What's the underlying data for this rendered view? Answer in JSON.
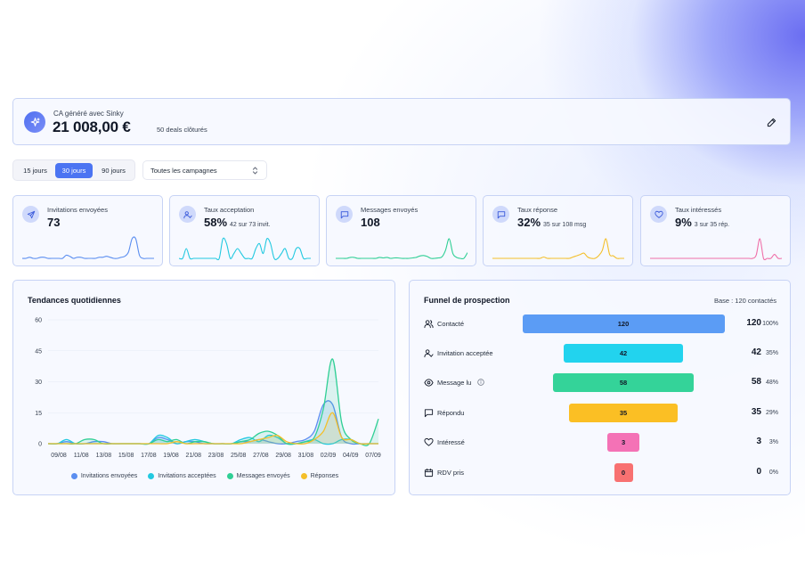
{
  "banner": {
    "label": "CA généré avec Sinky",
    "amount": "21 008,00 €",
    "deals": "50 deals clôturés"
  },
  "periods": [
    {
      "label": "15 jours",
      "active": false
    },
    {
      "label": "30 jours",
      "active": true
    },
    {
      "label": "90 jours",
      "active": false
    }
  ],
  "campaign_select": {
    "value": "Toutes les campagnes"
  },
  "kpis": [
    {
      "title": "Invitations envoyées",
      "value": "73",
      "sub": "",
      "color": "#5b8ef0",
      "icon": "send-icon"
    },
    {
      "title": "Taux acceptation",
      "value": "58%",
      "sub": "42 sur 73 invit.",
      "color": "#22c9e0",
      "icon": "user-check-icon"
    },
    {
      "title": "Messages envoyés",
      "value": "108",
      "sub": "",
      "color": "#2fcf95",
      "icon": "message-icon"
    },
    {
      "title": "Taux réponse",
      "value": "32%",
      "sub": "35 sur 108 msg",
      "color": "#f4bf2a",
      "icon": "chat-icon"
    },
    {
      "title": "Taux intéressés",
      "value": "9%",
      "sub": "3 sur 35 rép.",
      "color": "#ef6fa8",
      "icon": "heart-icon"
    }
  ],
  "trend": {
    "title": "Tendances quotidiennes",
    "legend": [
      "Invitations envoyées",
      "Invitations acceptées",
      "Messages envoyés",
      "Réponses"
    ]
  },
  "chart_data": {
    "type": "area",
    "title": "Tendances quotidiennes",
    "x_ticks": [
      "09/08",
      "11/08",
      "13/08",
      "15/08",
      "17/08",
      "19/08",
      "21/08",
      "23/08",
      "25/08",
      "27/08",
      "29/08",
      "31/08",
      "02/09",
      "04/09",
      "07/09"
    ],
    "y_ticks": [
      0,
      15,
      30,
      45,
      60
    ],
    "ylim": [
      0,
      60
    ],
    "n_points": 31,
    "series": [
      {
        "name": "Invitations envoyées",
        "color": "#5b8ef0",
        "values": [
          0,
          0,
          1,
          0,
          0,
          1,
          1,
          0,
          0,
          0,
          0,
          0,
          3,
          2,
          0,
          1,
          1,
          0,
          0,
          0,
          0,
          1,
          1,
          2,
          1,
          0,
          0,
          1,
          2,
          6,
          19,
          19,
          3,
          0,
          0,
          0,
          0
        ]
      },
      {
        "name": "Invitations acceptées",
        "color": "#22c9e0",
        "values": [
          0,
          0,
          2,
          0,
          0,
          0,
          0,
          0,
          0,
          0,
          0,
          0,
          4,
          3,
          0,
          1,
          2,
          1,
          0,
          0,
          0,
          2,
          3,
          1,
          4,
          3,
          0,
          0,
          1,
          2,
          0,
          0,
          2,
          2,
          0,
          0,
          0
        ]
      },
      {
        "name": "Messages envoyés",
        "color": "#2fcf95",
        "values": [
          0,
          0,
          0,
          0,
          2,
          2,
          0,
          0,
          0,
          0,
          0,
          0,
          2,
          1,
          2,
          0,
          1,
          1,
          0,
          0,
          0,
          1,
          2,
          5,
          6,
          4,
          0,
          0,
          1,
          3,
          17,
          41,
          10,
          2,
          0,
          0,
          12
        ]
      },
      {
        "name": "Réponses",
        "color": "#f4bf2a",
        "values": [
          0,
          0,
          0,
          0,
          0,
          0,
          0,
          0,
          0,
          0,
          0,
          0,
          0,
          0,
          1,
          0,
          0,
          0,
          0,
          0,
          0,
          0,
          1,
          2,
          3,
          4,
          1,
          0,
          0,
          2,
          6,
          15,
          3,
          2,
          0,
          0,
          0
        ]
      }
    ]
  },
  "funnel": {
    "title": "Funnel de prospection",
    "base": "Base : 120 contactés",
    "stages": [
      {
        "label": "Contacté",
        "value": 120,
        "count": "120",
        "pct": "100%",
        "color": "#5b9cf5",
        "icon": "users-icon"
      },
      {
        "label": "Invitation acceptée",
        "value": 42,
        "count": "42",
        "pct": "35%",
        "color": "#22d3ee",
        "icon": "user-check-icon"
      },
      {
        "label": "Message lu",
        "value": 58,
        "count": "58",
        "pct": "48%",
        "color": "#34d399",
        "icon": "eye-icon"
      },
      {
        "label": "Répondu",
        "value": 35,
        "count": "35",
        "pct": "29%",
        "color": "#fbbf24",
        "icon": "message-icon"
      },
      {
        "label": "Intéressé",
        "value": 3,
        "count": "3",
        "pct": "3%",
        "color": "#f472b6",
        "icon": "heart-icon"
      },
      {
        "label": "RDV pris",
        "value": 0,
        "count": "0",
        "pct": "0%",
        "color": "#f87171",
        "icon": "calendar-icon"
      }
    ]
  }
}
